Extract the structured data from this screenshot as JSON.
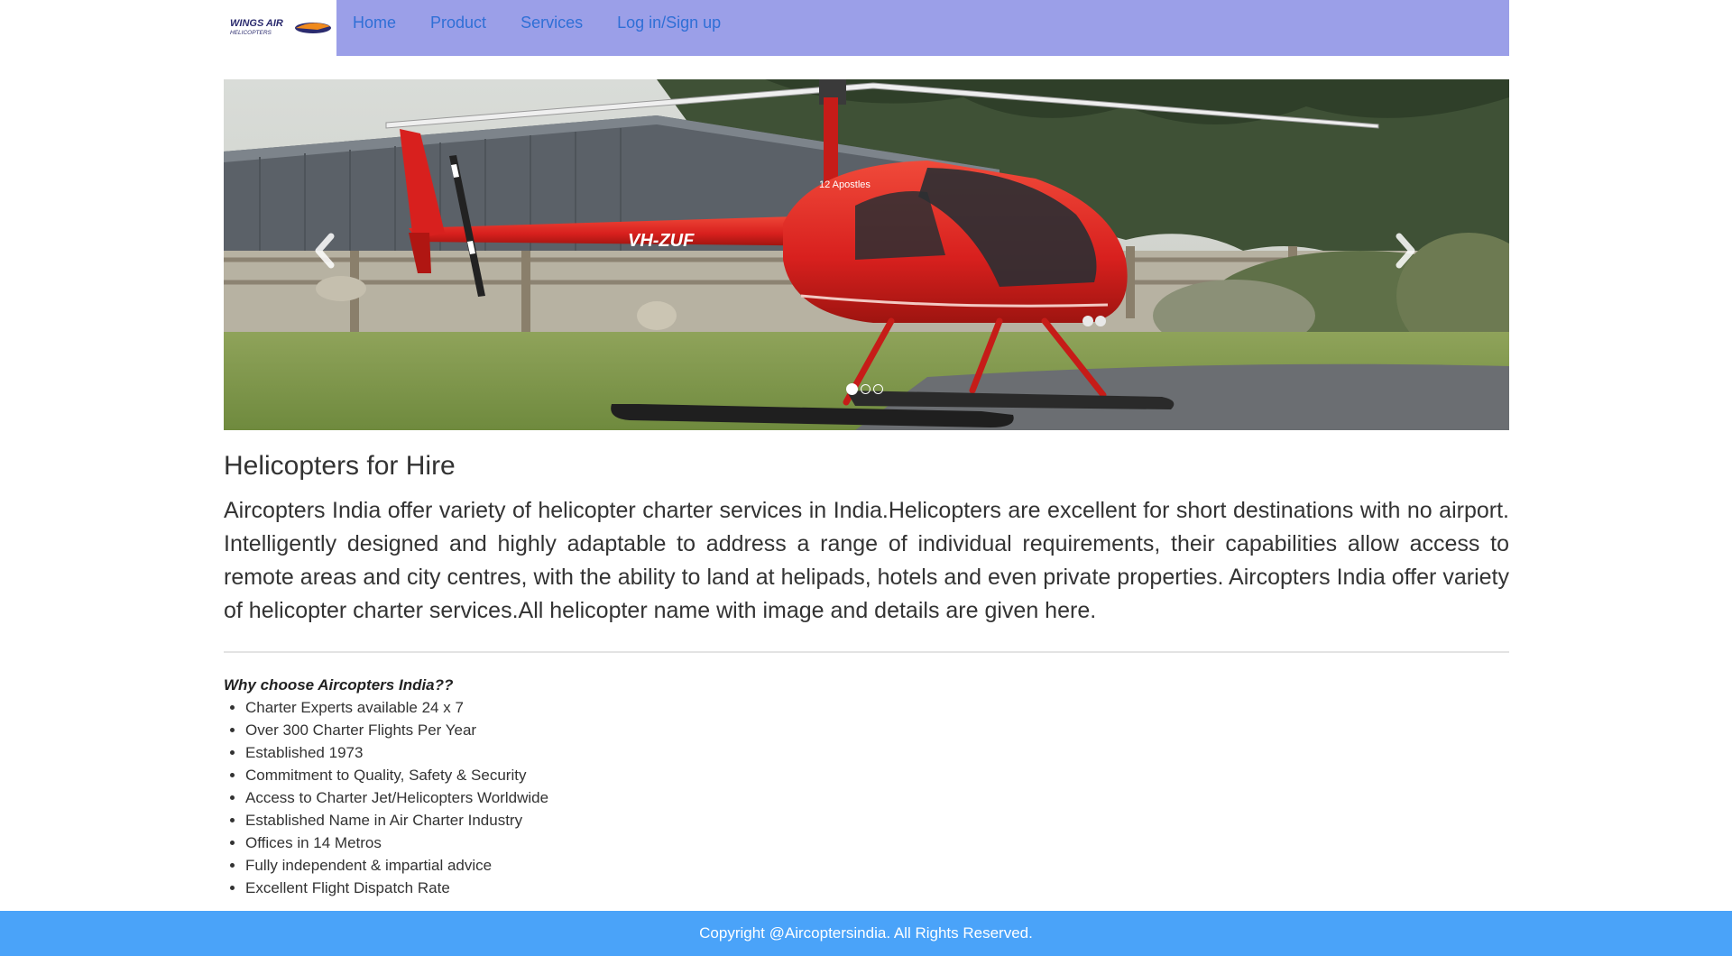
{
  "logo": {
    "line1": "WINGS AIR",
    "line2": "HELICOPTERS"
  },
  "nav": {
    "items": [
      {
        "label": "Home"
      },
      {
        "label": "Product"
      },
      {
        "label": "Services"
      },
      {
        "label": "Log in/Sign up"
      }
    ]
  },
  "carousel": {
    "aircraft_registration": "VH-ZUF",
    "tail_text": "12 Apostles",
    "slide_count": 3,
    "active_slide": 1,
    "prev_icon": "chevron-left-icon",
    "next_icon": "chevron-right-icon"
  },
  "main": {
    "heading": "Helicopters for Hire",
    "intro": "Aircopters India offer variety of helicopter charter services in India.Helicopters are excellent for short destinations with no airport. Intelligently designed and highly adaptable to address a range of individual requirements, their capabilities allow access to remote areas and city centres, with the ability to land at helipads, hotels and even private properties. Aircopters India offer variety of helicopter charter services.All helicopter name with image and details are given here.",
    "why_title": "Why choose Aircopters India??",
    "reasons": [
      "Charter Experts available 24 x 7",
      "Over 300 Charter Flights Per Year",
      "Established 1973",
      "Commitment to Quality, Safety & Security",
      "Access to Charter Jet/Helicopters Worldwide",
      "Established Name in Air Charter Industry",
      "Offices in 14 Metros",
      "Fully independent & impartial advice",
      "Excellent Flight Dispatch Rate"
    ]
  },
  "footer": {
    "text": "Copyright @Aircoptersindia. All Rights Reserved."
  },
  "colors": {
    "nav_bg": "#9b9fe8",
    "nav_link": "#2f6fd6",
    "footer_bg": "#4aa3f9",
    "helicopter_red": "#d8201e"
  }
}
